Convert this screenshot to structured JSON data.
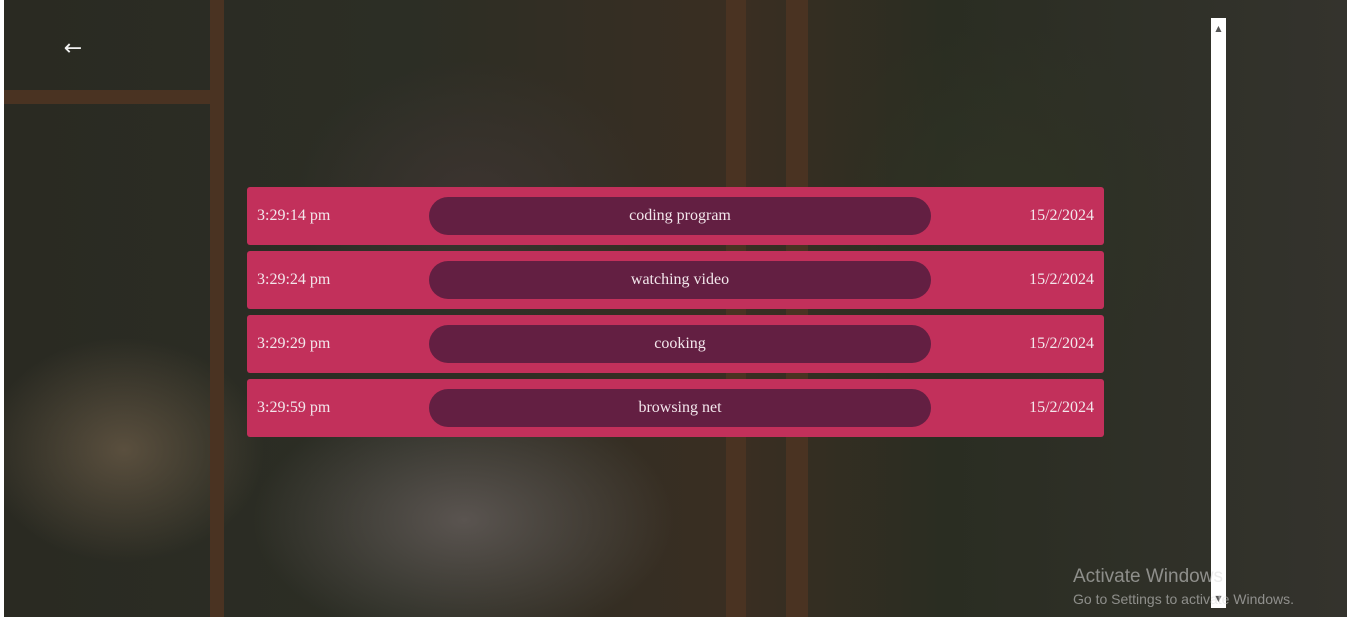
{
  "nav": {
    "back_icon": "arrow-left-icon",
    "back_glyph": "←"
  },
  "entries": [
    {
      "time": "3:29:14 pm",
      "activity": "coding program",
      "date": "15/2/2024"
    },
    {
      "time": "3:29:24 pm",
      "activity": "watching video",
      "date": "15/2/2024"
    },
    {
      "time": "3:29:29 pm",
      "activity": "cooking",
      "date": "15/2/2024"
    },
    {
      "time": "3:29:59 pm",
      "activity": "browsing net",
      "date": "15/2/2024"
    }
  ],
  "scrollbar": {
    "up_glyph": "▲",
    "down_glyph": "▼"
  },
  "watermark": {
    "title": "Activate Windows",
    "subtitle": "Go to Settings to activate Windows."
  },
  "colors": {
    "row": "#c2305b",
    "pill": "#631f42"
  }
}
